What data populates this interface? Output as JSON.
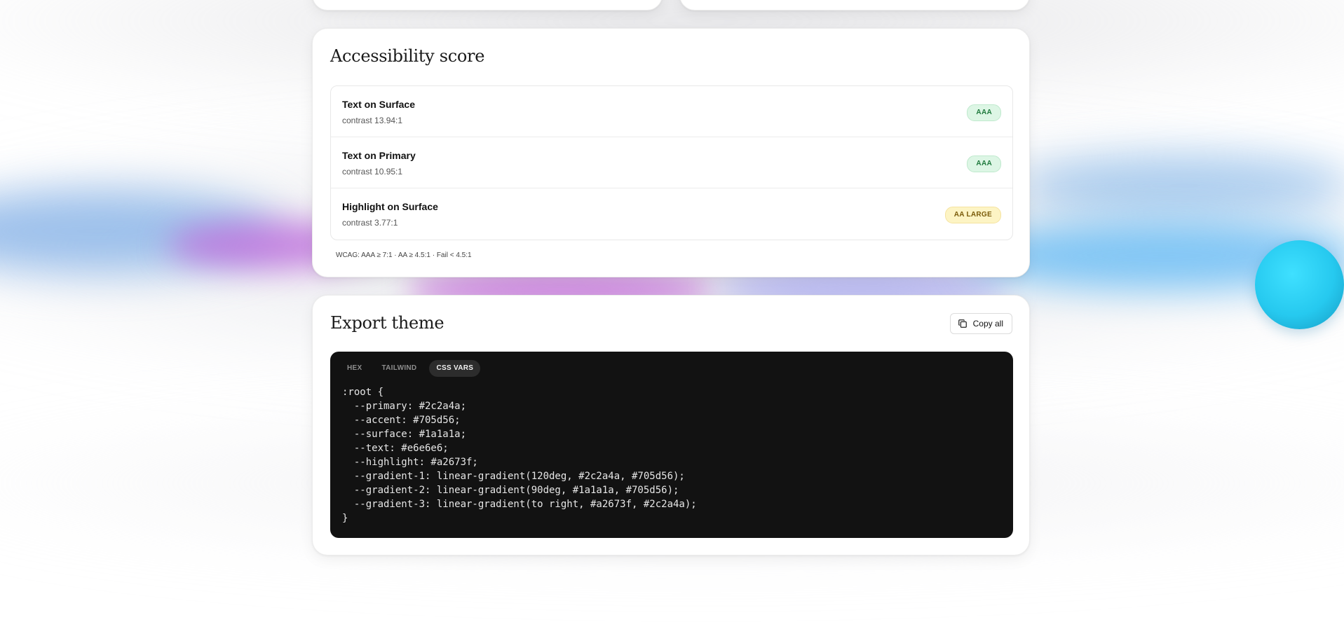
{
  "accessibility": {
    "title": "Accessibility score",
    "rows": [
      {
        "title": "Text on Surface",
        "contrast": "contrast 13.94:1",
        "badge": "AAA",
        "badge_color": "#ddf6e5"
      },
      {
        "title": "Text on Primary",
        "contrast": "contrast 10.95:1",
        "badge": "AAA",
        "badge_color": "#ddf6e5"
      },
      {
        "title": "Highlight on Surface",
        "contrast": "contrast 3.77:1",
        "badge": "AA LARGE",
        "badge_color": "#fdf4c4"
      }
    ],
    "note": "WCAG: AAA ≥ 7:1 · AA ≥ 4.5:1 · Fail < 4.5:1"
  },
  "export": {
    "title": "Export theme",
    "copy_label": "Copy all",
    "copy_icon": "copy-icon",
    "tabs": [
      "HEX",
      "TAILWIND",
      "CSS VARS"
    ],
    "active_tab": "CSS VARS",
    "code_lines": [
      ":root {",
      "  --primary: #2c2a4a;",
      "  --accent: #705d56;",
      "  --surface: #1a1a1a;",
      "  --text: #e6e6e6;",
      "  --highlight: #a2673f;",
      "  --gradient-1: linear-gradient(120deg, #2c2a4a, #705d56);",
      "  --gradient-2: linear-gradient(90deg, #1a1a1a, #705d56);",
      "  --gradient-3: linear-gradient(to right, #a2673f, #2c2a4a);",
      "}"
    ]
  },
  "colors": {
    "code_bg": "#121212",
    "sphere": "#26c9ef",
    "badge_aaa_text": "#1f7a3d",
    "badge_aalarge_text": "#7a5b09"
  }
}
